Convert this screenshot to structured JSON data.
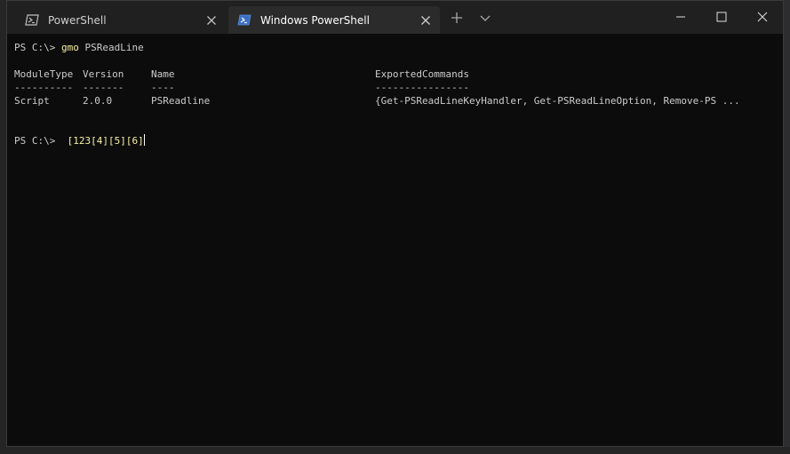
{
  "tabs": [
    {
      "title": "PowerShell",
      "active": false
    },
    {
      "title": "Windows PowerShell",
      "active": true
    }
  ],
  "terminal": {
    "prompt": "PS C:\\>",
    "command_alias": "gmo",
    "command_arg": "PSReadLine",
    "table": {
      "headers": [
        "ModuleType",
        "Version",
        "Name",
        "ExportedCommands"
      ],
      "underlines": [
        "----------",
        "-------",
        "----",
        "----------------"
      ],
      "rows": [
        [
          "Script",
          "2.0.0",
          "PSReadline",
          "{Get-PSReadLineKeyHandler, Get-PSReadLineOption, Remove-PS ..."
        ]
      ]
    },
    "current_input": "[123[4][5][6]"
  },
  "colors": {
    "terminal_bg": "#0c0c0c",
    "text": "#cccccc",
    "command": "#f9f1a5",
    "titlebar": "#202020",
    "active_tab": "#2b2b2b"
  },
  "icons": {
    "tab": "powershell-icon",
    "new_tab": "plus-icon",
    "dropdown": "chevron-down-icon",
    "minimize": "minimize-icon",
    "maximize": "maximize-icon",
    "close": "close-icon"
  }
}
